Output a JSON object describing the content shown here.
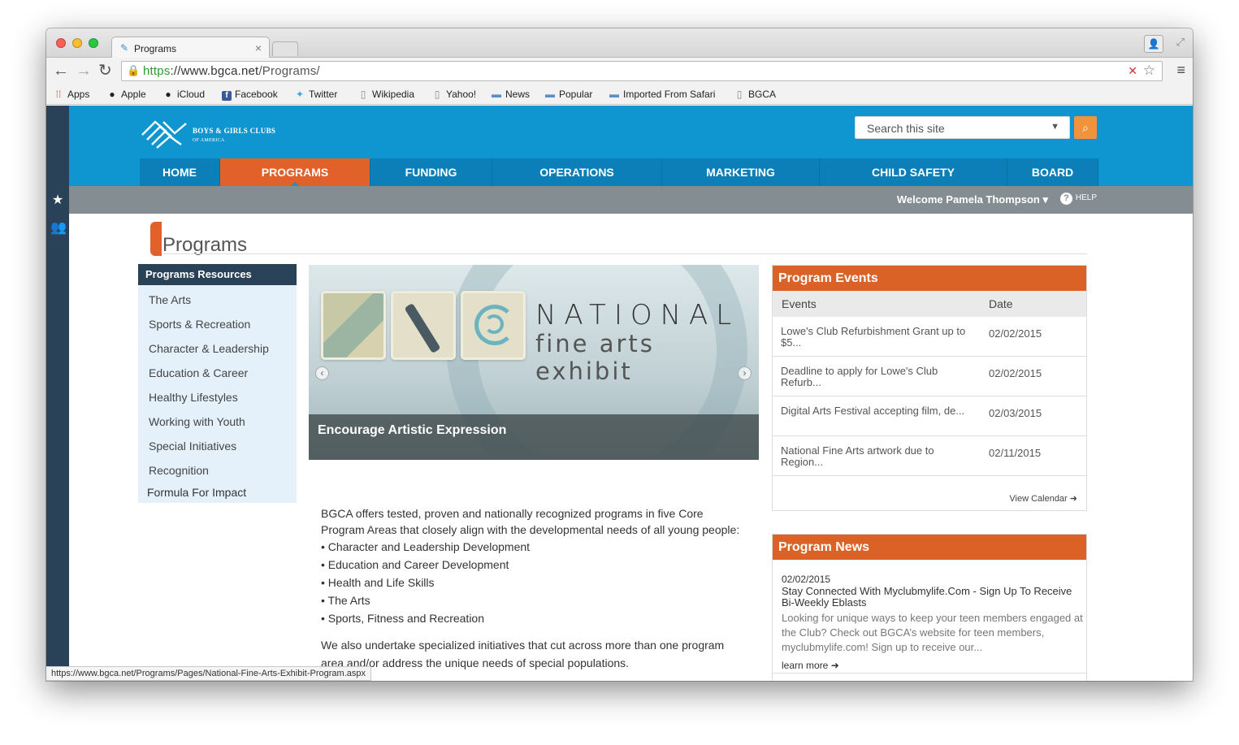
{
  "browser": {
    "tab_title": "Programs",
    "url_scheme": "https",
    "url_sep": "://",
    "url_host": "www.bgca.net",
    "url_path": "/Programs/",
    "bookmarks": [
      "Apps",
      "Apple",
      "iCloud",
      "Facebook",
      "Twitter",
      "Wikipedia",
      "Yahoo!",
      "News",
      "Popular",
      "Imported From Safari",
      "BGCA"
    ],
    "status_url": "https://www.bgca.net/Programs/Pages/National-Fine-Arts-Exhibit-Program.aspx"
  },
  "header": {
    "logo_line1": "BOYS & GIRLS CLUBS",
    "logo_line2": "OF AMERICA",
    "search_placeholder": "Search this site",
    "nav": [
      "HOME",
      "PROGRAMS",
      "FUNDING",
      "OPERATIONS",
      "MARKETING",
      "CHILD SAFETY",
      "BOARD"
    ],
    "active_nav": "PROGRAMS",
    "welcome": "Welcome Pamela Thompson",
    "help": "HELP"
  },
  "page": {
    "title": "Programs"
  },
  "sidebar": {
    "heading": "Programs Resources",
    "items": [
      "The Arts",
      "Sports & Recreation",
      "Character & Leadership",
      "Education & Career",
      "Healthy Lifestyles",
      "Working with Youth",
      "Special Initiatives",
      "Recognition",
      "Formula For Impact"
    ]
  },
  "slider": {
    "headline1": "NATIONAL",
    "headline2": "fine arts exhibit",
    "caption": "Encourage Artistic Expression"
  },
  "body": {
    "intro": "BGCA offers tested, proven and nationally recognized programs in five Core Program Areas that closely align with the developmental needs of all young people:",
    "list": [
      "• Character and Leadership Development",
      "• Education and Career Development",
      "• Health and Life Skills",
      "• The Arts",
      "• Sports, Fitness and Recreation"
    ],
    "para2": "We also undertake specialized initiatives that cut across more than one program area and/or address the unique needs of special populations."
  },
  "events": {
    "title": "Program Events",
    "col_events": "Events",
    "col_date": "Date",
    "rows": [
      {
        "name": "Lowe's Club Refurbishment Grant up to $5...",
        "date": "02/02/2015"
      },
      {
        "name": "Deadline to apply for Lowe's Club Refurb...",
        "date": "02/02/2015"
      },
      {
        "name": "Digital Arts Festival accepting film, de...",
        "date": "02/03/2015"
      },
      {
        "name": "National Fine Arts artwork due to Region...",
        "date": "02/11/2015"
      }
    ],
    "view_calendar": "View Calendar"
  },
  "news": {
    "title": "Program News",
    "date": "02/02/2015",
    "headline": "Stay Connected With Myclubmylife.Com - Sign Up To Receive Bi-Weekly Eblasts",
    "body": "Looking for unique ways to keep your teen members engaged at the Club? Check out BGCA’s website for teen members, myclubmylife.com! Sign up to receive our...",
    "learn_more": "learn more"
  },
  "icons": [
    "star-icon",
    "users-icon",
    "search-icon",
    "help-icon",
    "lock-icon",
    "reload-icon",
    "back-icon",
    "forward-icon",
    "menu-icon",
    "bookmark-star-icon"
  ],
  "colors": {
    "brand_blue": "#0f95cf",
    "nav_blue": "#0c7fb8",
    "accent_orange": "#e2612a",
    "rail": "#2a4258"
  }
}
